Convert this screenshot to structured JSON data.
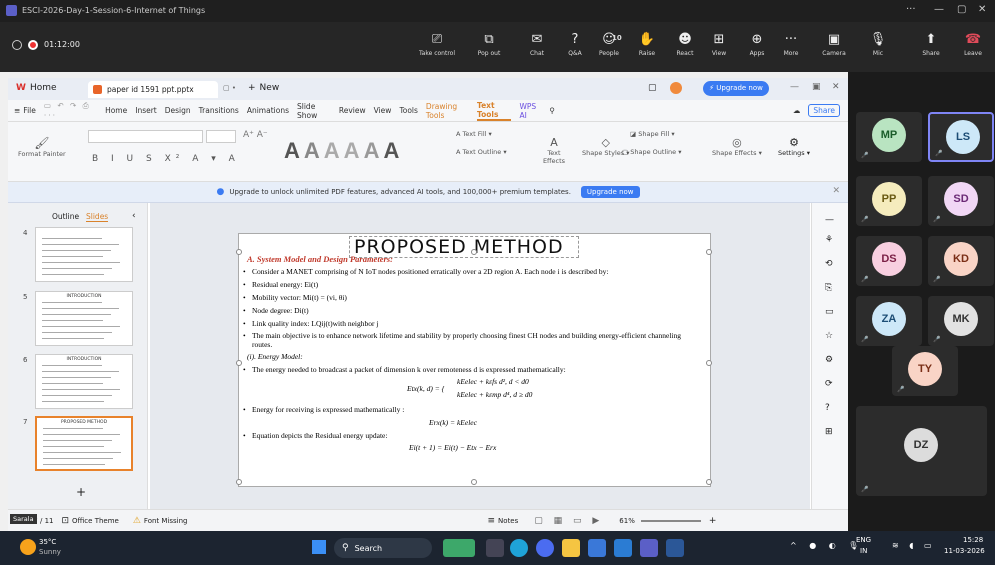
{
  "teams": {
    "title": "ESCI-2026-Day-1-Session-6-Internet of Things",
    "timer": "01:12:00",
    "controls": [
      {
        "label": "Take control",
        "icon": "screen-icon"
      },
      {
        "label": "Pop out",
        "icon": "popout-icon"
      },
      {
        "label": "Chat",
        "icon": "chat-icon"
      },
      {
        "label": "Q&A",
        "icon": "qa-icon"
      },
      {
        "label": "People",
        "icon": "people-icon",
        "badge": "10"
      },
      {
        "label": "Raise",
        "icon": "hand-icon"
      },
      {
        "label": "React",
        "icon": "smile-icon"
      },
      {
        "label": "View",
        "icon": "view-icon"
      },
      {
        "label": "Apps",
        "icon": "apps-icon"
      },
      {
        "label": "More",
        "icon": "more-icon"
      }
    ],
    "camera_label": "Camera",
    "mic_label": "Mic",
    "share_label": "Share",
    "leave_label": "Leave",
    "participants": [
      "MP",
      "LS",
      "PP",
      "SD",
      "DS",
      "KD",
      "ZA",
      "MK",
      "TY",
      "DZ"
    ],
    "colors": {
      "accent": "#c4314b",
      "avatar_bg": "#2c2c2c"
    }
  },
  "wps": {
    "home_tab": "Home",
    "file_tab": "paper id 1591 ppt.pptx",
    "new_tab": "New",
    "upgrade_btn": "Upgrade now",
    "menu": [
      "File",
      "Home",
      "Insert",
      "Design",
      "Transitions",
      "Animations",
      "Slide Show",
      "Review",
      "View",
      "Tools",
      "Drawing Tools",
      "Text Tools",
      "WPS AI"
    ],
    "share_label": "Share",
    "format_painter": "Format Painter",
    "ribbon": {
      "text_fill": "Text Fill",
      "text_outline": "Text Outline",
      "text_effects": "Text Effects",
      "shape_styles": "Shape Styles",
      "shape_fill": "Shape Fill",
      "shape_outline": "Shape Outline",
      "shape_effects": "Shape Effects",
      "settings": "Settings"
    },
    "banner_text": "Upgrade to unlock unlimited PDF features, advanced AI tools, and 100,000+ premium templates.",
    "banner_btn": "Upgrade now",
    "side_tabs": {
      "outline": "Outline",
      "slides": "Slides"
    },
    "thumbs": [
      {
        "num": "4"
      },
      {
        "num": "5",
        "title": "INTRODUCTION"
      },
      {
        "num": "6",
        "title": "INTRODUCTION"
      },
      {
        "num": "7",
        "title": "PROPOSED METHOD"
      }
    ],
    "add_slide": "+",
    "status": {
      "slide": "Slide 7 / 11",
      "theme": "Office Theme",
      "font": "Font Missing",
      "notes": "Notes",
      "zoom": "61%",
      "presenter": "Sarala"
    }
  },
  "slide": {
    "title": "PROPOSED METHOD",
    "section": "A. System Model and Design Parameters:",
    "bullets": [
      "Consider a MANET comprising of N IoT nodes positioned erratically over a 2D region A. Each node i is described by:",
      "Residual energy: Ei(t)",
      "Mobility vector: Mi(t) = (vi, θi)",
      "Node degree: Di(t)",
      "Link quality index: LQij(t)with neighbor j",
      "The main objective is to enhance network lifetime and stability by properly choosing finest CH nodes and building energy-efficient channeling routes."
    ],
    "subsection": "(i). Energy Model:",
    "energy_bullet": "The energy needed to broadcast a packet of dimension k over remoteness d is expressed mathematically:",
    "eq1_lhs": "Etx(k, d) = {",
    "eq1_a": "kEelec + kεfs d²,   d < d0",
    "eq1_b": "kEelec + kεmp d⁴,   d ≥ d0",
    "rx_bullet": "Energy for receiving is expressed mathematically :",
    "eq2": "Erx(k) = kEelec",
    "res_bullet": "Equation depicts the Residual energy update:",
    "eq3": "Ei(t + 1) = Ei(t) − Etx − Erx"
  },
  "taskbar": {
    "weather_temp": "35°C",
    "weather_desc": "Sunny",
    "search": "Search",
    "lang": "ENG",
    "region": "IN",
    "time": "15:28",
    "date": "11-03-2026"
  }
}
